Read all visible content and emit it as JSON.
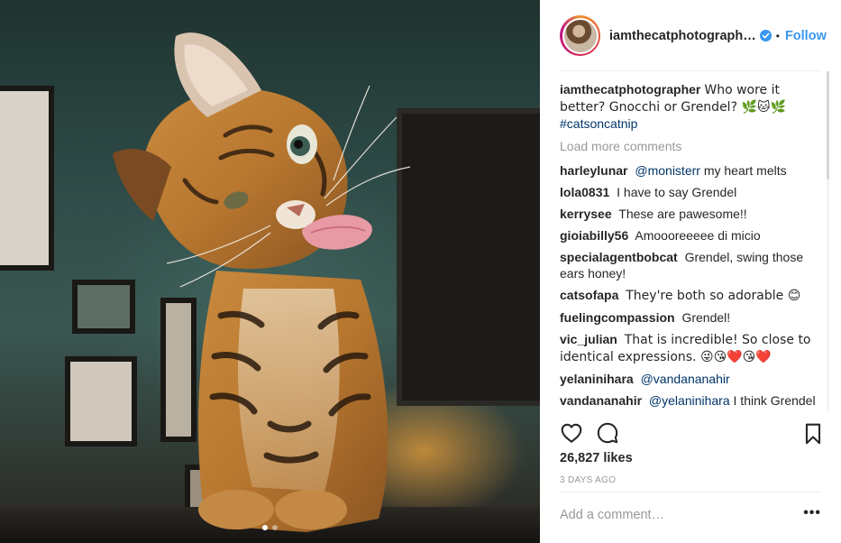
{
  "post": {
    "image_alt": "Bengal cat licking its nose",
    "carousel_dot_count": 2,
    "carousel_active_index": 0
  },
  "header": {
    "username": "iamthecatphotograph…",
    "separator": "•",
    "follow_label": "Follow",
    "verified_icon": "verified-badge-icon"
  },
  "caption": {
    "username": "iamthecatphotographer",
    "text": "Who wore it better? Gnocchi or Grendel? 🌿🐱🌿",
    "hashtag": "#catsoncatnip"
  },
  "load_more_label": "Load more comments",
  "comments": [
    {
      "username": "harleylunar",
      "mention": "@monisterr",
      "text": "my heart melts"
    },
    {
      "username": "lola0831",
      "mention": "",
      "text": "I have to say Grendel"
    },
    {
      "username": "kerrysee",
      "mention": "",
      "text": "These are pawesome!!"
    },
    {
      "username": "gioiabilly56",
      "mention": "",
      "text": "Amoooreeeee di micio"
    },
    {
      "username": "specialagentbobcat",
      "mention": "",
      "text": "Grendel, swing those ears honey!"
    },
    {
      "username": "catsofapa",
      "mention": "",
      "text": "They're both so adorable 😊"
    },
    {
      "username": "fuelingcompassion",
      "mention": "",
      "text": "Grendel!"
    },
    {
      "username": "vic_julian",
      "mention": "",
      "text": "That is incredible! So close to identical expressions. 😜😘❤️😘❤️"
    },
    {
      "username": "yelaninihara",
      "mention": "@vandananahir",
      "text": ""
    },
    {
      "username": "vandananahir",
      "mention": "@yelaninihara",
      "text": "I think Grendel captured the essence well"
    }
  ],
  "actions": {
    "like_icon": "heart-icon",
    "comment_icon": "comment-bubble-icon",
    "save_icon": "bookmark-icon"
  },
  "likes": "26,827 likes",
  "timestamp": "3 DAYS AGO",
  "add_comment": {
    "placeholder": "Add a comment…",
    "value": "",
    "more_label": "•••"
  },
  "colors": {
    "link_blue": "#3897f0",
    "mention_blue": "#003569",
    "muted": "#999999",
    "text": "#262626"
  }
}
